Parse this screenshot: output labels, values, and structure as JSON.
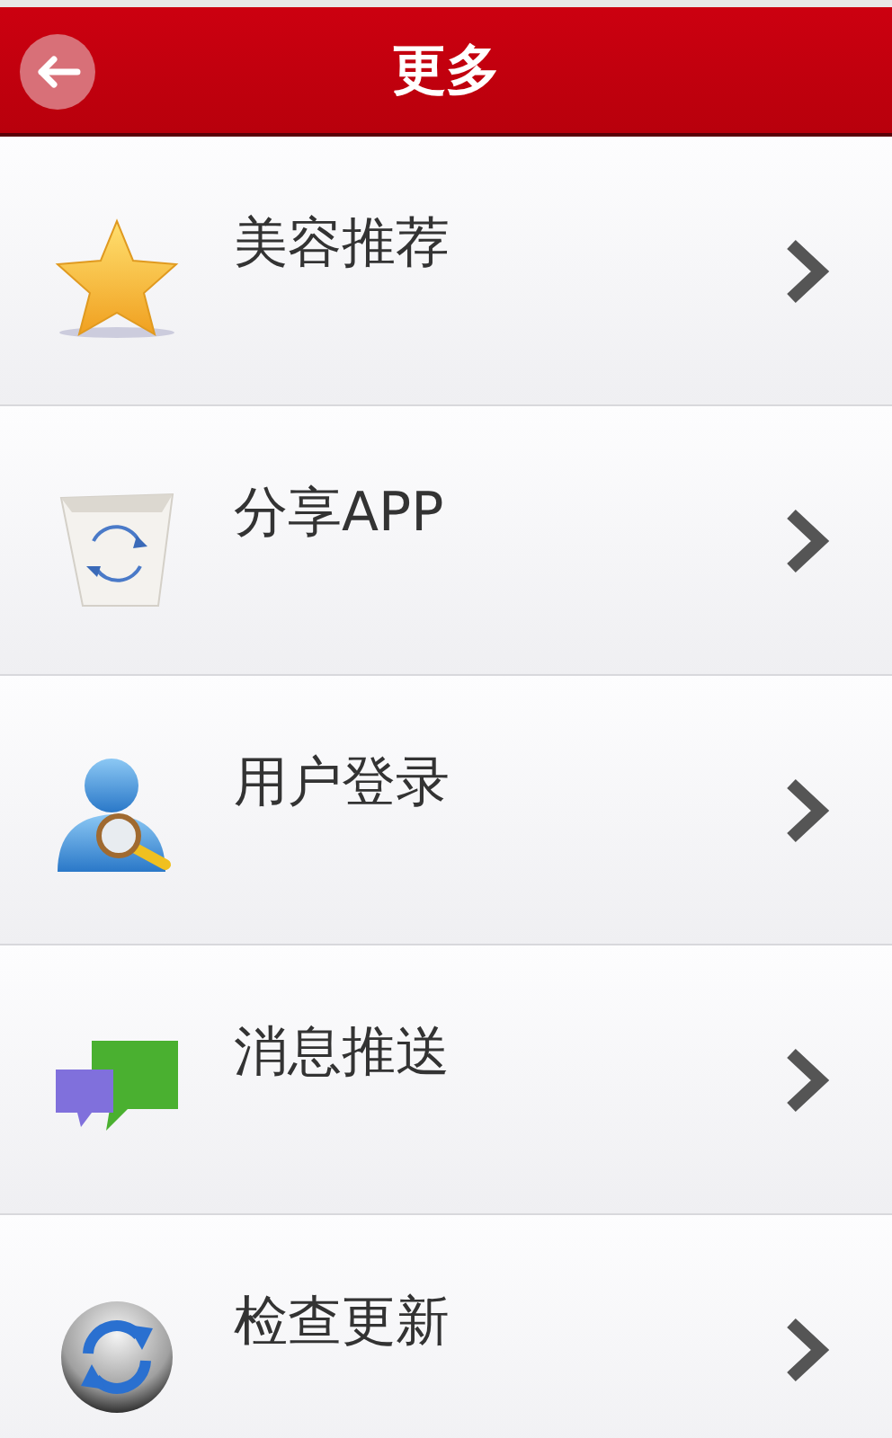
{
  "header": {
    "title": "更多"
  },
  "items": [
    {
      "label": "美容推荐",
      "kind": "star"
    },
    {
      "label": "分享APP",
      "kind": "bin"
    },
    {
      "label": "用户登录",
      "kind": "user"
    },
    {
      "label": "消息推送",
      "kind": "chat"
    },
    {
      "label": "检查更新",
      "kind": "refresh"
    }
  ]
}
